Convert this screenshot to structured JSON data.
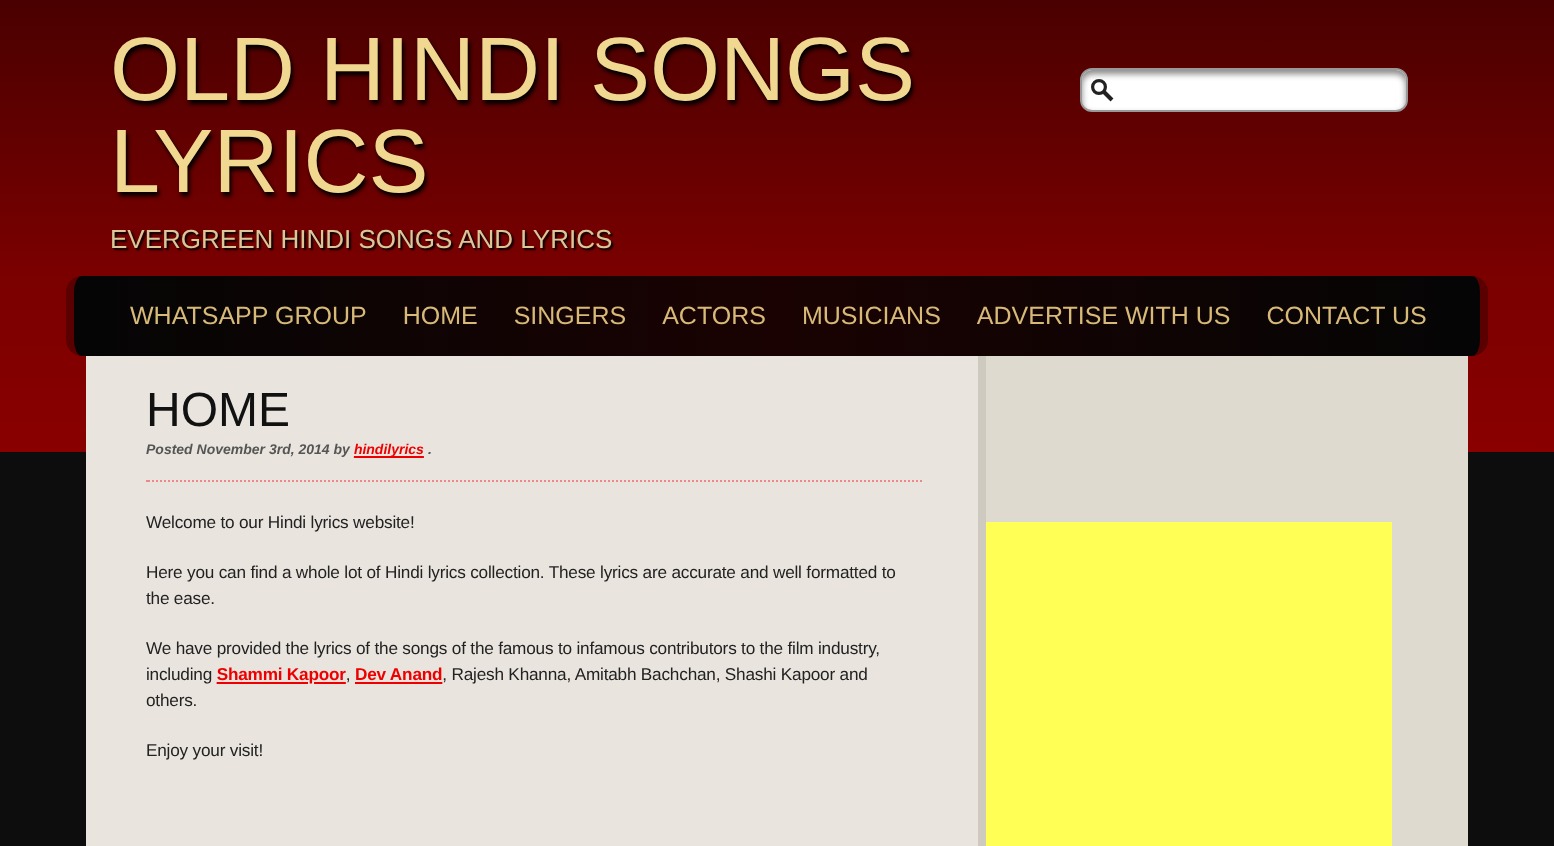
{
  "site": {
    "title": "OLD HINDI SONGS LYRICS",
    "tagline": "EVERGREEN HINDI SONGS AND LYRICS"
  },
  "nav": [
    {
      "label": "WHATSAPP GROUP"
    },
    {
      "label": "HOME"
    },
    {
      "label": "SINGERS"
    },
    {
      "label": "ACTORS"
    },
    {
      "label": "MUSICIANS"
    },
    {
      "label": "ADVERTISE WITH US"
    },
    {
      "label": "CONTACT US"
    }
  ],
  "post": {
    "title": "HOME",
    "meta": [
      {
        "kind": "text",
        "text": "Posted November 3rd, 2014 by"
      },
      {
        "kind": "link",
        "text": "hindilyrics"
      },
      {
        "kind": "text",
        "text": "."
      }
    ],
    "paragraphs": [
      [
        {
          "kind": "text",
          "text": "Welcome to our Hindi lyrics website!"
        }
      ],
      [
        {
          "kind": "text",
          "text": "Here you can find a whole lot of Hindi lyrics collection. These lyrics are accurate and well formatted to the ease."
        }
      ],
      [
        {
          "kind": "text",
          "text": "We have provided the lyrics of the songs of the famous to infamous contributors to the film industry, including "
        },
        {
          "kind": "link",
          "text": "Shammi Kapoor"
        },
        {
          "kind": "text",
          "text": ", "
        },
        {
          "kind": "link",
          "text": "Dev Anand"
        },
        {
          "kind": "text",
          "text": ", Rajesh Khanna, Amitabh Bachchan, Shashi Kapoor and others."
        }
      ],
      [
        {
          "kind": "text",
          "text": "Enjoy your visit!"
        }
      ]
    ]
  }
}
